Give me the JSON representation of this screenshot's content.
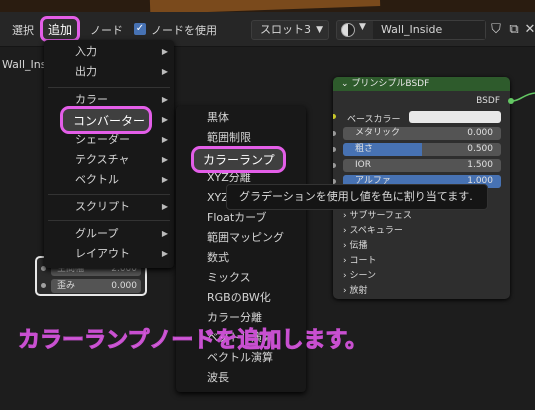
{
  "header": {
    "select_label": "選択",
    "add_label": "追加",
    "node_label": "ノード",
    "use_nodes_label": "ノードを使用",
    "slot": "スロット3",
    "material_name": "Wall_Inside"
  },
  "editor": {
    "object_label": "Wall_Ins"
  },
  "add_menu": {
    "items": [
      "入力",
      "出力",
      "カラー",
      "コンバーター",
      "シェーダー",
      "テクスチャ",
      "ベクトル",
      "スクリプト",
      "グループ",
      "レイアウト"
    ],
    "highlighted": "コンバーター"
  },
  "converter_menu": {
    "items": [
      "黒体",
      "範囲制限",
      "カラーランプ",
      "XYZ分離",
      "XYZ",
      "Floatカーブ",
      "範囲マッピング",
      "数式",
      "ミックス",
      "RGBのBW化",
      "カラー分離",
      "ベクトル演算",
      "ベクトル演算",
      "波長"
    ],
    "highlighted": "カラーランプ"
  },
  "tooltip": "グラデーションを使用し値を色に割り当てます.",
  "left_node": {
    "rows": [
      {
        "label": "空間幅",
        "value": "2.000"
      },
      {
        "label": "歪み",
        "value": "0.000"
      }
    ]
  },
  "principled_node": {
    "title": "プリンシプルBSDF",
    "output": "BSDF",
    "base_color_label": "ベースカラー",
    "base_color": "#e8e8e8",
    "fields": [
      {
        "label": "メタリック",
        "value": "0.000",
        "fill": 0
      },
      {
        "label": "粗さ",
        "value": "0.500",
        "fill": 0.5
      },
      {
        "label": "IOR",
        "value": "1.500",
        "fill": 0
      },
      {
        "label": "アルファ",
        "value": "1.000",
        "fill": 1
      }
    ],
    "sections": [
      "サブサーフェス",
      "スペキュラー",
      "伝播",
      "コート",
      "シーン",
      "放射"
    ]
  },
  "caption": "カラーランプノードを追加します。",
  "colors": {
    "highlight": "#e35ee8",
    "accent": "#4772b3",
    "node_header": "#2e5b2c",
    "caption": "#f3b9f0"
  },
  "icons": [
    "checkbox-icon",
    "material-ball-icon",
    "shield-icon",
    "copy-icon",
    "delete-icon",
    "chevron-down-icon",
    "chevron-right-icon"
  ]
}
